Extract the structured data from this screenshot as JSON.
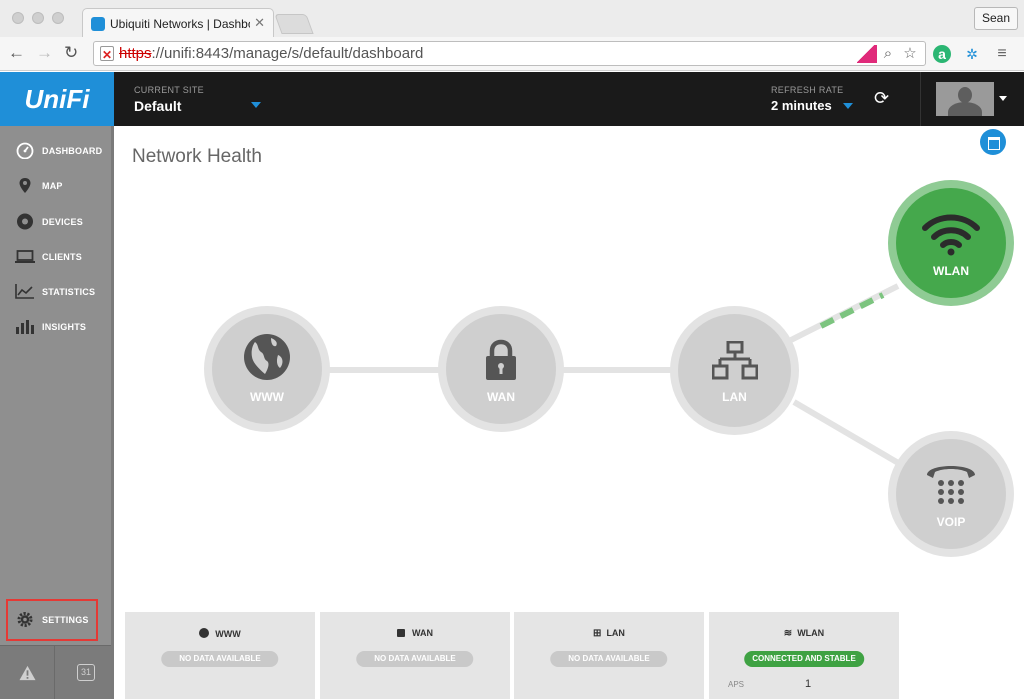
{
  "browser": {
    "tab_title": "Ubiquiti Networks | Dashbo",
    "user_name": "Sean",
    "url_scheme": "https",
    "url_rest": "://unifi:8443/manage/s/default/dashboard"
  },
  "app": {
    "logo_text": "UniFi",
    "site_label": "CURRENT SITE",
    "site_value": "Default",
    "refresh_label": "REFRESH RATE",
    "refresh_value": "2 minutes"
  },
  "sidebar": {
    "items": [
      {
        "label": "DASHBOARD",
        "icon": "dashboard-icon"
      },
      {
        "label": "MAP",
        "icon": "map-pin-icon"
      },
      {
        "label": "DEVICES",
        "icon": "devices-icon"
      },
      {
        "label": "CLIENTS",
        "icon": "laptop-icon"
      },
      {
        "label": "STATISTICS",
        "icon": "line-chart-icon"
      },
      {
        "label": "INSIGHTS",
        "icon": "bar-chart-icon"
      }
    ],
    "settings_label": "SETTINGS",
    "calendar_day": "31"
  },
  "main": {
    "title": "Network Health",
    "nodes": {
      "www": "WWW",
      "wan": "WAN",
      "lan": "LAN",
      "wlan": "WLAN",
      "voip": "VOIP"
    },
    "cards": [
      {
        "title": "WWW",
        "status": "NO DATA AVAILABLE"
      },
      {
        "title": "WAN",
        "status": "NO DATA AVAILABLE"
      },
      {
        "title": "LAN",
        "status": "NO DATA AVAILABLE"
      },
      {
        "title": "WLAN",
        "status": "CONNECTED AND STABLE",
        "row_label": "APS",
        "row_value": "1"
      }
    ]
  },
  "colors": {
    "accent": "#1f8fd8",
    "healthy": "#45a84c",
    "header": "#1a1a1a",
    "sidebar": "#8f8f8f"
  }
}
